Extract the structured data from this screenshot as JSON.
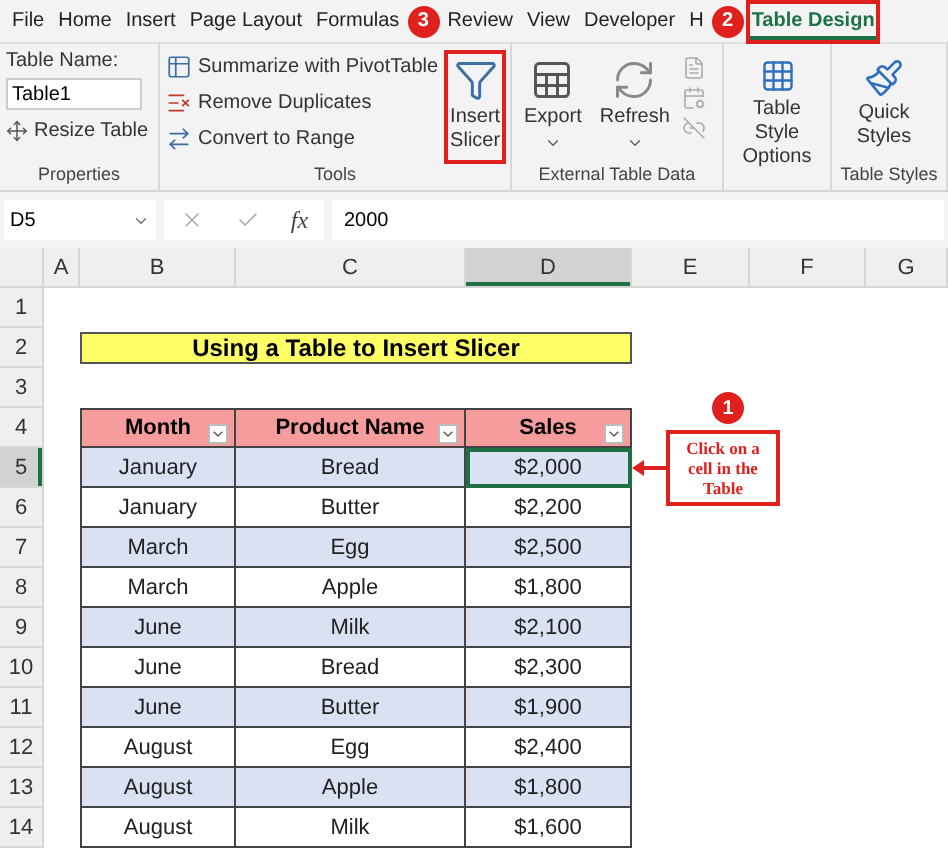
{
  "ribbon": {
    "tabs": [
      {
        "label": "File",
        "selected": false,
        "highlighted": false
      },
      {
        "label": "Home",
        "selected": false,
        "highlighted": false
      },
      {
        "label": "Insert",
        "selected": false,
        "highlighted": false
      },
      {
        "label": "Page Layout",
        "selected": false,
        "highlighted": false
      },
      {
        "label": "Formulas",
        "selected": false,
        "highlighted": false
      },
      {
        "label": "Review",
        "selected": false,
        "highlighted": false,
        "marker": "3"
      },
      {
        "label": "View",
        "selected": false,
        "highlighted": false
      },
      {
        "label": "Developer",
        "selected": false,
        "highlighted": false
      },
      {
        "label": "H",
        "selected": false,
        "highlighted": false
      },
      {
        "label": "Table Design",
        "selected": true,
        "highlighted": true,
        "marker": "2"
      }
    ],
    "groups": [
      {
        "kind": "properties",
        "label": "Properties",
        "name_label": "Table Name:",
        "name_value": "Table1",
        "items": [
          "Resize Table"
        ]
      },
      {
        "kind": "tools",
        "label": "Tools",
        "items": [
          "Summarize with PivotTable",
          "Remove Duplicates",
          "Convert to Range"
        ],
        "big_button": {
          "label": "Insert Slicer",
          "highlighted": true
        }
      },
      {
        "kind": "external",
        "label": "External Table Data",
        "items": [
          "Export",
          "Refresh"
        ]
      },
      {
        "kind": "style_options",
        "items": [
          "Table Style Options"
        ]
      },
      {
        "kind": "styles",
        "label": "Table Styles",
        "items": [
          "Quick Styles"
        ]
      }
    ]
  },
  "formula_bar": {
    "name_box": "D5",
    "function_label": "fx",
    "value": "2000"
  },
  "sheet": {
    "columns": [
      {
        "label": "A",
        "selected": false
      },
      {
        "label": "B",
        "selected": false
      },
      {
        "label": "C",
        "selected": false
      },
      {
        "label": "D",
        "selected": true
      },
      {
        "label": "E",
        "selected": false
      },
      {
        "label": "F",
        "selected": false
      },
      {
        "label": "G",
        "selected": false
      }
    ],
    "row_headers": [
      {
        "label": "1",
        "selected": false
      },
      {
        "label": "2",
        "selected": false
      },
      {
        "label": "3",
        "selected": false
      },
      {
        "label": "4",
        "selected": false
      },
      {
        "label": "5",
        "selected": true
      },
      {
        "label": "6",
        "selected": false
      },
      {
        "label": "7",
        "selected": false
      },
      {
        "label": "8",
        "selected": false
      },
      {
        "label": "9",
        "selected": false
      },
      {
        "label": "10",
        "selected": false
      },
      {
        "label": "11",
        "selected": false
      },
      {
        "label": "12",
        "selected": false
      },
      {
        "label": "13",
        "selected": false
      },
      {
        "label": "14",
        "selected": false
      }
    ],
    "title": "Using a Table to Insert Slicer",
    "table": {
      "columns": [
        "Month",
        "Product Name",
        "Sales"
      ],
      "rows": [
        {
          "cells": [
            {
              "text": "January",
              "selected": false
            },
            {
              "text": "Bread",
              "selected": false
            },
            {
              "text": "$2,000",
              "selected": true
            }
          ]
        },
        {
          "cells": [
            {
              "text": "January",
              "selected": false
            },
            {
              "text": "Butter",
              "selected": false
            },
            {
              "text": "$2,200",
              "selected": false
            }
          ]
        },
        {
          "cells": [
            {
              "text": "March",
              "selected": false
            },
            {
              "text": "Egg",
              "selected": false
            },
            {
              "text": "$2,500",
              "selected": false
            }
          ]
        },
        {
          "cells": [
            {
              "text": "March",
              "selected": false
            },
            {
              "text": "Apple",
              "selected": false
            },
            {
              "text": "$1,800",
              "selected": false
            }
          ]
        },
        {
          "cells": [
            {
              "text": "June",
              "selected": false
            },
            {
              "text": "Milk",
              "selected": false
            },
            {
              "text": "$2,100",
              "selected": false
            }
          ]
        },
        {
          "cells": [
            {
              "text": "June",
              "selected": false
            },
            {
              "text": "Bread",
              "selected": false
            },
            {
              "text": "$2,300",
              "selected": false
            }
          ]
        },
        {
          "cells": [
            {
              "text": "June",
              "selected": false
            },
            {
              "text": "Butter",
              "selected": false
            },
            {
              "text": "$1,900",
              "selected": false
            }
          ]
        },
        {
          "cells": [
            {
              "text": "August",
              "selected": false
            },
            {
              "text": "Egg",
              "selected": false
            },
            {
              "text": "$2,400",
              "selected": false
            }
          ]
        },
        {
          "cells": [
            {
              "text": "August",
              "selected": false
            },
            {
              "text": "Apple",
              "selected": false
            },
            {
              "text": "$1,800",
              "selected": false
            }
          ]
        },
        {
          "cells": [
            {
              "text": "August",
              "selected": false
            },
            {
              "text": "Milk",
              "selected": false
            },
            {
              "text": "$1,600",
              "selected": false
            }
          ]
        }
      ]
    },
    "callout": {
      "marker": "1",
      "text": "Click on a cell in the Table"
    }
  }
}
